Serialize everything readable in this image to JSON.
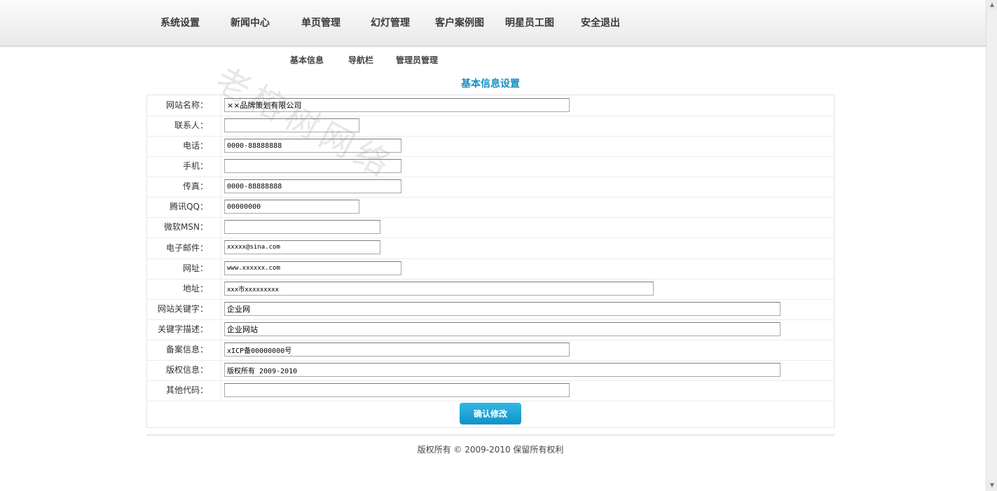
{
  "topnav": [
    {
      "label": "系统设置"
    },
    {
      "label": "新闻中心"
    },
    {
      "label": "单页管理"
    },
    {
      "label": "幻灯管理"
    },
    {
      "label": "客户案例图"
    },
    {
      "label": "明星员工图"
    },
    {
      "label": "安全退出"
    }
  ],
  "subnav": [
    {
      "label": "基本信息"
    },
    {
      "label": "导航栏"
    },
    {
      "label": "管理员管理"
    }
  ],
  "watermark": "老榕树网络",
  "section_title": "基本信息设置",
  "form": {
    "rows": [
      {
        "label": "网站名称：",
        "value": "××品牌策划有限公司"
      },
      {
        "label": "联系人：",
        "value": ""
      },
      {
        "label": "电话：",
        "value": "0000-88888888"
      },
      {
        "label": "手机：",
        "value": ""
      },
      {
        "label": "传真：",
        "value": "0000-88888888"
      },
      {
        "label": "腾讯QQ：",
        "value": "00000000"
      },
      {
        "label": "微软MSN：",
        "value": ""
      },
      {
        "label": "电子邮件：",
        "value": "xxxxx@sina.com"
      },
      {
        "label": "网址：",
        "value": "www.xxxxxx.com"
      },
      {
        "label": "地址：",
        "value": "xxx市xxxxxxxxx"
      },
      {
        "label": "网站关键字：",
        "value": "企业网"
      },
      {
        "label": "关键字描述：",
        "value": "企业网站"
      },
      {
        "label": "备案信息：",
        "value": "xICP备00000000号"
      },
      {
        "label": "版权信息：",
        "value": "版权所有 2009-2010"
      },
      {
        "label": "其他代码：",
        "value": ""
      }
    ],
    "submit_label": "确认修改"
  },
  "footer": {
    "text": "版权所有 © 2009-2010 保留所有权利"
  },
  "colors": {
    "accent": "#1a8fc2",
    "button": "#1ba3d6"
  }
}
